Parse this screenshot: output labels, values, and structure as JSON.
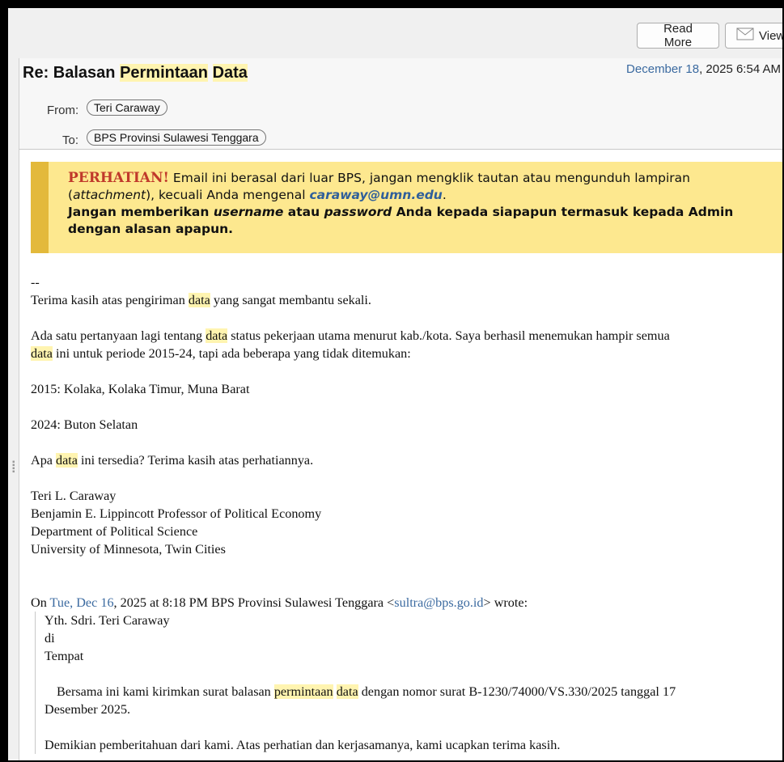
{
  "toolbar": {
    "read_more": "Read More",
    "view": "View"
  },
  "message": {
    "subject_prefix": "Re: Balasan",
    "subject_hl1": "Permintaan",
    "subject_hl2": "Data",
    "date_month_day": "December 18",
    "date_rest": ", 2025 6:54 AM",
    "from_label": "From:",
    "from_value": "Teri Caraway",
    "to_label": "To:",
    "to_value": "BPS Provinsi Sulawesi Tenggara"
  },
  "warning": {
    "title": "PERHATIAN!",
    "line1": " Email ini berasal dari luar BPS, jangan mengklik tautan atau mengunduh lampiran",
    "line2_a": "(",
    "line2_em": "attachment",
    "line2_b": "), kecuali Anda mengenal ",
    "sender_email": "caraway@umn.edu",
    "line2_end": ".",
    "line3_a": "Jangan memberikan ",
    "line3_u": "username",
    "line3_b": " atau ",
    "line3_p": "password",
    "line3_c": " Anda kepada siapapun termasuk kepada Admin",
    "line4": "dengan alasan apapun."
  },
  "body": {
    "sig_sep": "--",
    "p1_a": "Terima kasih atas pengiriman ",
    "hl_data": "data",
    "p1_b": " yang sangat membantu sekali.",
    "p2_a": "Ada satu pertanyaan lagi tentang ",
    "p2_b": " status pekerjaan utama menurut kab./kota. Saya berhasil menemukan hampir semua",
    "p2_c": " ini untuk periode 2015-24, tapi ada beberapa yang tidak ditemukan:",
    "p3": "2015: Kolaka, Kolaka Timur, Muna Barat",
    "p4": "2024: Buton Selatan",
    "p5_a": "Apa ",
    "p5_b": " ini tersedia? Terima kasih atas perhatiannya.",
    "sig1": "Teri L. Caraway",
    "sig2": "Benjamin E. Lippincott Professor of Political Economy",
    "sig3": "Department of Political Science",
    "sig4": "University of Minnesota, Twin Cities",
    "on_a": "On ",
    "on_date": "Tue, Dec 16",
    "on_b": ", 2025 at 8:18 PM BPS Provinsi Sulawesi Tenggara <",
    "on_email": "sultra@bps.go.id",
    "on_c": "> wrote:",
    "q1": "Yth. Sdri. Teri Caraway",
    "q2": "di",
    "q3": "Tempat",
    "q4_a": "Bersama ini kami kirimkan surat balasan ",
    "q4_hl1": "permintaan",
    "q4_hl2": "data",
    "q4_b": " dengan nomor surat B-1230/74000/VS.330/2025 tanggal 17",
    "q5": "Desember 2025.",
    "q6": "Demikian pemberitahuan dari kami. Atas perhatian dan kerjasamanya, kami ucapkan terima kasih."
  }
}
